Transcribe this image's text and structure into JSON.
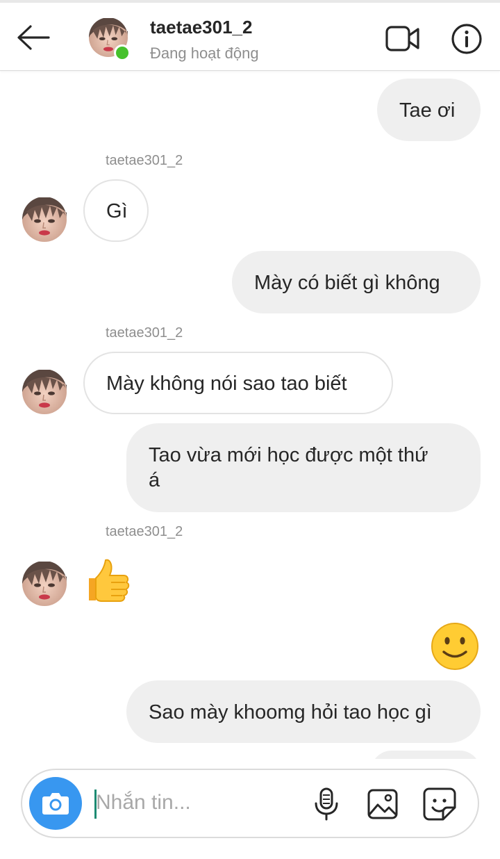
{
  "header": {
    "username": "taetae301_2",
    "status": "Đang hoạt động"
  },
  "messages": [
    {
      "from": "me",
      "text": "Tae ơi"
    },
    {
      "from": "them",
      "sender": "taetae301_2",
      "text": "Gì"
    },
    {
      "from": "me",
      "text": "Mày có biết gì không"
    },
    {
      "from": "them",
      "sender": "taetae301_2",
      "text": "Mày không nói sao tao biết"
    },
    {
      "from": "me",
      "line1": "Tao vừa mới học được một thứ",
      "line2": "á"
    },
    {
      "from": "them",
      "sender": "taetae301_2",
      "emoji": "thumbs-up"
    },
    {
      "from": "me",
      "emoji": "slightly-smiling-face"
    },
    {
      "from": "me",
      "text": "Sao mày khoomg hỏi tao học gì"
    }
  ],
  "composer": {
    "placeholder": "Nhắn tin..."
  },
  "colors": {
    "accent": "#3897f0",
    "online": "#46c12c",
    "bubble_me": "#efefef",
    "bubble_them_border": "#e3e3e3",
    "muted_text": "#8e8e8e"
  },
  "icons": [
    "back-arrow-icon",
    "video-call-icon",
    "info-icon",
    "camera-icon",
    "microphone-icon",
    "gallery-icon",
    "sticker-icon"
  ]
}
